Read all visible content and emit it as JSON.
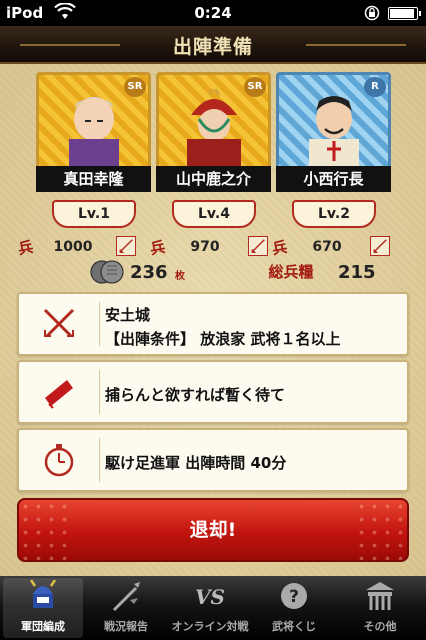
{
  "status_bar": {
    "carrier": "iPod",
    "time": "0:24",
    "battery_level": 0.85
  },
  "header": {
    "title": "出陣準備"
  },
  "generals": [
    {
      "name": "真田幸隆",
      "rarity": "SR",
      "level": "Lv.1",
      "troop_label": "兵",
      "troops": "1000"
    },
    {
      "name": "山中鹿之介",
      "rarity": "SR",
      "level": "Lv.4",
      "troop_label": "兵",
      "troops": "970"
    },
    {
      "name": "小西行長",
      "rarity": "R",
      "level": "Lv.2",
      "troop_label": "兵",
      "troops": "670"
    }
  ],
  "resources": {
    "coins": "236",
    "coins_unit": "枚",
    "total_troops_label": "総兵糧",
    "total_troops": "215"
  },
  "mission": {
    "castle": "安土城",
    "condition": "【出陣条件】 放浪家 武将１名以上",
    "motto": "捕らんと欲すれば暫く待て",
    "march": "駆け足進軍 出陣時間 40分"
  },
  "retreat_button": "退却!",
  "tabs": [
    {
      "label": "軍団編成",
      "icon": "kabuto-icon",
      "active": true
    },
    {
      "label": "戦況報告",
      "icon": "spear-icon",
      "active": false
    },
    {
      "label": "オンライン対戦",
      "icon": "vs-icon",
      "active": false
    },
    {
      "label": "武将くじ",
      "icon": "lottery-icon",
      "active": false
    },
    {
      "label": "その他",
      "icon": "castle-gate-icon",
      "active": false
    }
  ]
}
